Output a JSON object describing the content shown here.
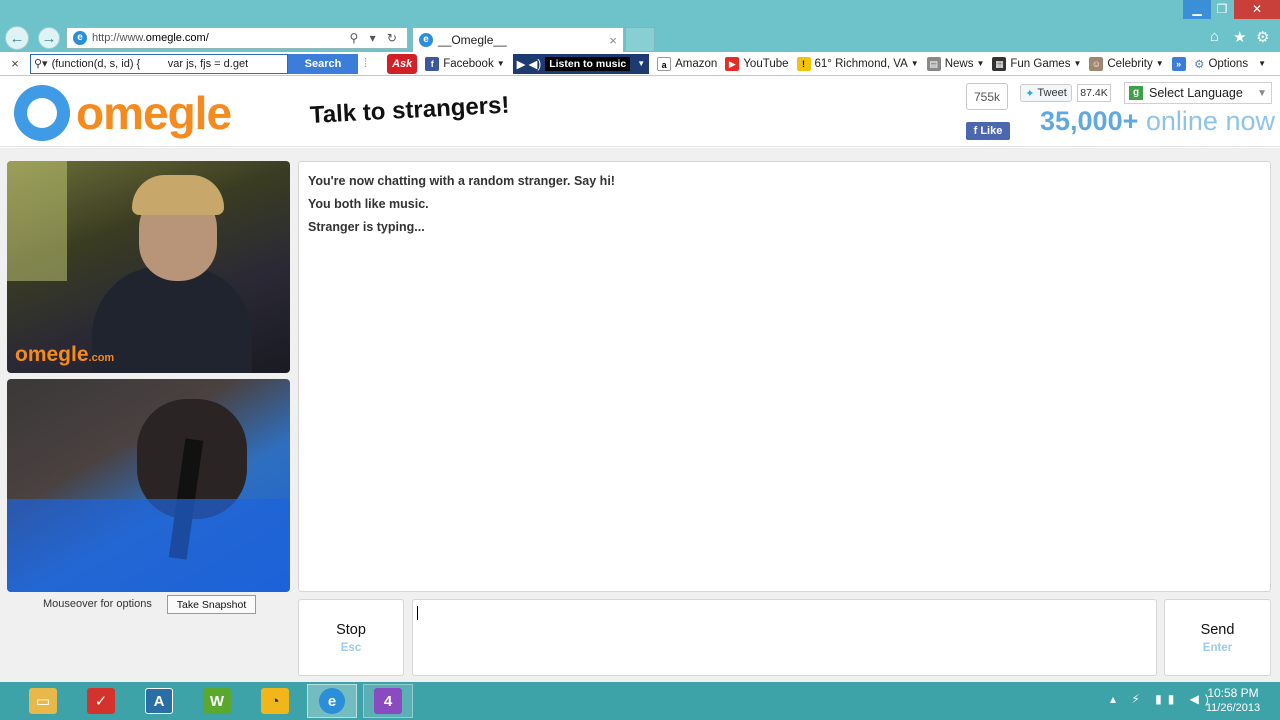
{
  "browser": {
    "url_prefix": "http://www.",
    "url_domain": "omegle.com/",
    "address_tools": "⚲ ▾ ↻",
    "tab_title": "__Omegle__",
    "tab_close": "×",
    "window_controls": {
      "minimize": "▁",
      "restore": "❐",
      "close": "✕"
    },
    "top_icons": {
      "home": "⌂",
      "favorites": "★",
      "settings": "⚙"
    },
    "back": "←",
    "forward": "→"
  },
  "toolbar": {
    "close": "×",
    "search_value": "(function(d, s, id) {         var js, fjs = d.get",
    "search_button": "Search",
    "ask_label": "Ask",
    "facebook": "Facebook",
    "music_label": "Listen to music",
    "amazon": "Amazon",
    "youtube": "YouTube",
    "weather": "61° Richmond, VA",
    "news": "News",
    "fun_games": "Fun Games",
    "celebrity": "Celebrity",
    "more": "»",
    "options": "Options"
  },
  "header": {
    "logo_text": "omegle",
    "tagline": "Talk to strangers!",
    "fb_count": "755k",
    "fb_like": "Like",
    "tweet": "Tweet",
    "tweet_count": "87.4K",
    "select_language": "Select Language",
    "online_count": "35,000+",
    "online_label": "online now"
  },
  "video": {
    "watermark": "omegle",
    "watermark_suffix": ".com",
    "mouseover_text": "Mouseover for options",
    "snapshot_button": "Take Snapshot"
  },
  "chat": {
    "messages": [
      "You're now chatting with a random stranger. Say hi!",
      "You both like music.",
      "Stranger is typing..."
    ],
    "stop_label": "Stop",
    "stop_hint": "Esc",
    "send_label": "Send",
    "send_hint": "Enter",
    "input_value": ""
  },
  "taskbar": {
    "tray_icons": "▴ ⚡ ▮▮ ◀)",
    "time": "10:58 PM",
    "date": "11/26/2013",
    "apps": [
      "file-explorer",
      "todoist",
      "app-a",
      "wordperfect",
      "speedometer",
      "internet-explorer",
      "media-player"
    ]
  },
  "colors": {
    "omegle_orange": "#f58a1f",
    "omegle_blue": "#3f9be6",
    "taskbar": "#3ea3a8",
    "titlebar": "#6dc3c9"
  }
}
